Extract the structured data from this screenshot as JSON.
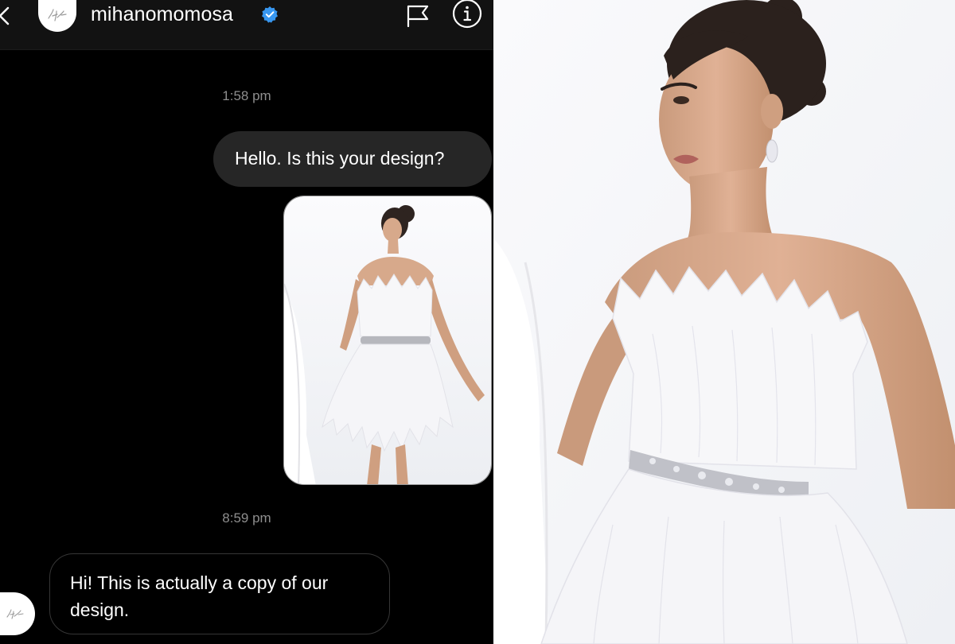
{
  "chat": {
    "header": {
      "username": "mihanomomosa",
      "back_icon": "chevron-left-icon",
      "verified_icon": "verified-badge-icon",
      "flag_icon": "flag-icon",
      "info_icon": "info-icon",
      "avatar_icon": "brand-logo-avatar"
    },
    "messages": [
      {
        "type": "timestamp",
        "text": "1:58 pm"
      },
      {
        "type": "outgoing-text",
        "text": "Hello. Is this your design?"
      },
      {
        "type": "outgoing-image",
        "description_icon": "photo-thumbnail"
      },
      {
        "type": "timestamp",
        "text": "8:59 pm"
      },
      {
        "type": "incoming-text",
        "text": "Hi! This is actually a copy of our design."
      }
    ]
  },
  "colors": {
    "chat_background": "#000000",
    "header_background": "#121212",
    "outgoing_bubble": "#262626",
    "incoming_bubble_border": "#363636",
    "timestamp_text": "#8e8e8e",
    "verified_badge": "#3897f0",
    "photo_background": "#f6f6f8"
  }
}
